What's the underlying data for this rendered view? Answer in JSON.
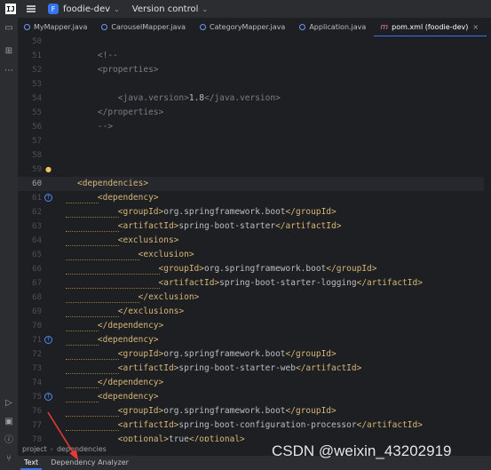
{
  "titlebar": {
    "project_badge": "F",
    "project_name": "foodie-dev",
    "vcs_label": "Version control"
  },
  "tabs": [
    {
      "label": "MyMapper.java"
    },
    {
      "label": "CarouselMapper.java"
    },
    {
      "label": "CategoryMapper.java"
    },
    {
      "label": "Application.java"
    },
    {
      "label": "pom.xml (foodie-dev)",
      "icon": "m"
    }
  ],
  "editor": {
    "lines": [
      {
        "n": "50",
        "code": ""
      },
      {
        "n": "51",
        "code": "    <!--"
      },
      {
        "n": "52",
        "code": "    <properties>"
      },
      {
        "n": "53",
        "code": ""
      },
      {
        "n": "54",
        "code": "        <java.version>1.8</java.version>"
      },
      {
        "n": "55",
        "code": "    </properties>"
      },
      {
        "n": "56",
        "code": "    -->"
      },
      {
        "n": "57",
        "code": ""
      },
      {
        "n": "58",
        "code": ""
      },
      {
        "n": "59",
        "code": ""
      },
      {
        "n": "60",
        "code": "<dependencies>"
      },
      {
        "n": "61",
        "code": "    <dependency>"
      },
      {
        "n": "62",
        "code": "        <groupId>org.springframework.boot</groupId>"
      },
      {
        "n": "63",
        "code": "        <artifactId>spring-boot-starter</artifactId>"
      },
      {
        "n": "64",
        "code": "        <exclusions>"
      },
      {
        "n": "65",
        "code": "            <exclusion>"
      },
      {
        "n": "66",
        "code": "                <groupId>org.springframework.boot</groupId>"
      },
      {
        "n": "67",
        "code": "                <artifactId>spring-boot-starter-logging</artifactId>"
      },
      {
        "n": "68",
        "code": "            </exclusion>"
      },
      {
        "n": "69",
        "code": "        </exclusions>"
      },
      {
        "n": "70",
        "code": "    </dependency>"
      },
      {
        "n": "71",
        "code": "    <dependency>"
      },
      {
        "n": "72",
        "code": "        <groupId>org.springframework.boot</groupId>"
      },
      {
        "n": "73",
        "code": "        <artifactId>spring-boot-starter-web</artifactId>"
      },
      {
        "n": "74",
        "code": "    </dependency>"
      },
      {
        "n": "75",
        "code": "    <dependency>"
      },
      {
        "n": "76",
        "code": "        <groupId>org.springframework.boot</groupId>"
      },
      {
        "n": "77",
        "code": "        <artifactId>spring-boot-configuration-processor</artifactId>"
      },
      {
        "n": "78",
        "code": "        <optional>true</optional>"
      }
    ]
  },
  "breadcrumb": [
    "project",
    "dependencies"
  ],
  "bottom_tabs": [
    "Text",
    "Dependency Analyzer"
  ],
  "watermark": "CSDN @weixin_43202919",
  "colors": {
    "accent": "#3574f0",
    "tag": "#d5b778",
    "background": "#1e1f22",
    "arrow": "#e53935"
  }
}
